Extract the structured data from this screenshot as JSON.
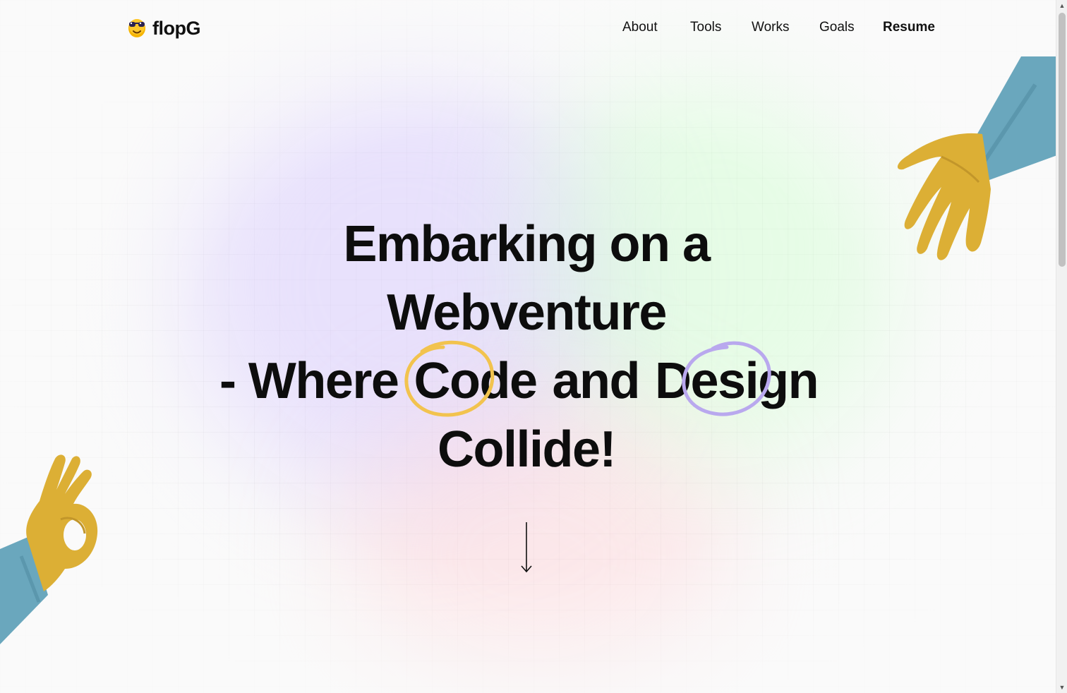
{
  "brand": {
    "name": "flopG",
    "logo_icon": "cool-emoji-icon"
  },
  "nav": {
    "about": "About",
    "tools": "Tools",
    "works": "Works",
    "goals": "Goals",
    "resume": "Resume"
  },
  "hero": {
    "line1": "Embarking on a Webventure",
    "line2_prefix": "- Where",
    "highlight1": "Code",
    "line2_mid": "and",
    "highlight2": "Design",
    "line3": "Collide!"
  },
  "colors": {
    "highlight1_circle": "#f2c34e",
    "highlight2_circle": "#b9a8ee",
    "skin": "#dcaf35",
    "sleeve": "#6aa7bd"
  },
  "icons": [
    "cool-emoji-icon",
    "scroll-down-arrow-icon",
    "open-hand-icon",
    "ok-hand-icon"
  ]
}
